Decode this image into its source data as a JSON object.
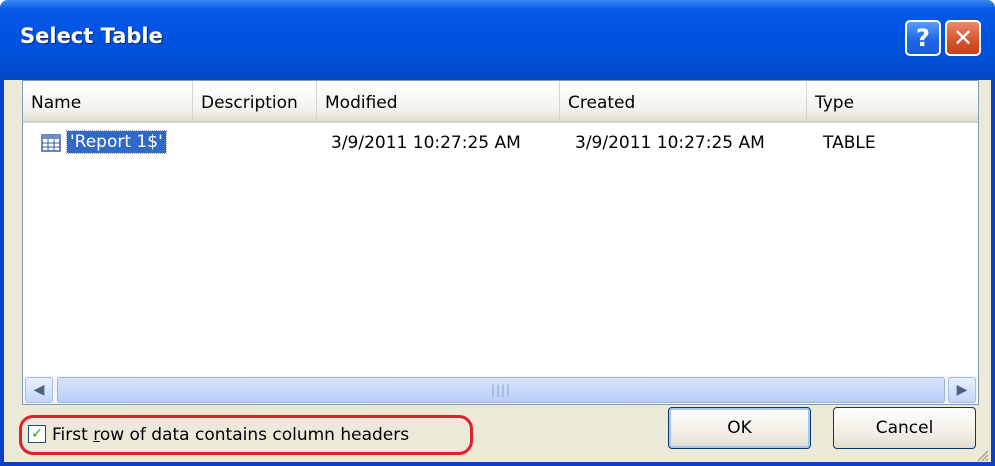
{
  "window": {
    "title": "Select Table",
    "help_label": "?",
    "close_label": "✕"
  },
  "list": {
    "columns": [
      "Name",
      "Description",
      "Modified",
      "Created",
      "Type"
    ],
    "rows": [
      {
        "name": "'Report 1$'",
        "description": "",
        "modified": "3/9/2011 10:27:25 AM",
        "created": "3/9/2011 10:27:25 AM",
        "type": "TABLE",
        "selected": true
      }
    ],
    "scroll_left": "◀",
    "scroll_right": "▶",
    "scroll_grip": "||||"
  },
  "options": {
    "first_row_headers_before": "First ",
    "first_row_headers_accel": "r",
    "first_row_headers_after": "ow of data contains column headers",
    "first_row_headers_checked": true,
    "check_mark": "✓"
  },
  "buttons": {
    "ok": "OK",
    "cancel": "Cancel"
  },
  "colors": {
    "title_bar": "#0054e3",
    "selection": "#316ac5",
    "highlight_ring": "#e0202a"
  }
}
